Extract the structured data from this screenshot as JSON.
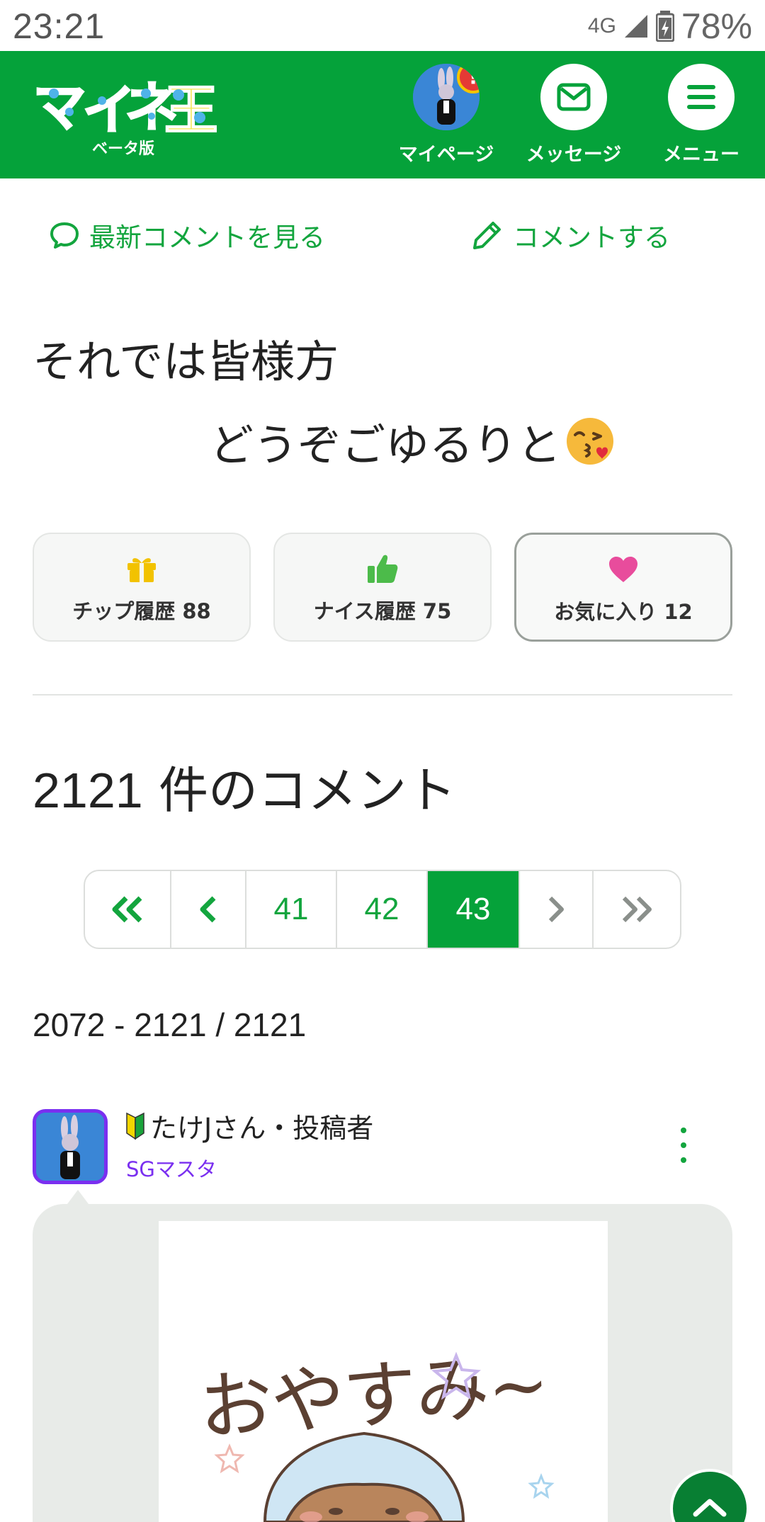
{
  "status_bar": {
    "time": "23:21",
    "network": "4G",
    "battery": "78%"
  },
  "header": {
    "logo_text": "マイネ王",
    "logo_sub": "ベータ版",
    "nav": {
      "mypage": "マイページ",
      "message": "メッセージ",
      "menu": "メニュー"
    },
    "badge": "!",
    "brand_color": "#05a23a"
  },
  "actions": {
    "latest_comments": "最新コメントを見る",
    "post_comment": "コメントする"
  },
  "post": {
    "line1": "それでは皆様方",
    "line2": "どうぞごゆるりと"
  },
  "stats": {
    "tip": "チップ履歴 88",
    "nice": "ナイス履歴 75",
    "favorite": "お気に入り 12"
  },
  "comments": {
    "count": "2121",
    "count_label": " 件のコメント",
    "pages": [
      "41",
      "42",
      "43"
    ],
    "current_page": "43",
    "range": "2072 - 2121 / 2121"
  },
  "comment": {
    "author": "たけJさん・投稿者",
    "rank": "SGマスタ",
    "rank_color": "#7a2ff0",
    "sticker_text": "おやすみ~"
  }
}
